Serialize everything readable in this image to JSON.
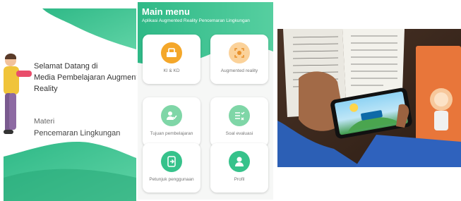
{
  "welcome_screen": {
    "greeting_line1": "Selamat Datang di",
    "greeting_line2": "Media Pembelajaran Augmente",
    "greeting_line3": "Reality",
    "materi_label": "Materi",
    "materi_subject": "Pencemaran Lingkungan"
  },
  "main_menu": {
    "title": "Main menu",
    "subtitle": "Aplikasi Augmented Reality Pencemaran Lingkungan",
    "items": [
      {
        "label": "KI & KD",
        "icon": "ki-kd-icon"
      },
      {
        "label": "Augmented reality",
        "icon": "augmented-reality-icon"
      },
      {
        "label": "Tujuan pembelajaran",
        "icon": "learning-goals-icon"
      },
      {
        "label": "Soal evaluasi",
        "icon": "evaluation-icon"
      },
      {
        "label": "Petunjuk penggunaan",
        "icon": "user-guide-icon"
      },
      {
        "label": "Profil",
        "icon": "profile-icon"
      }
    ]
  },
  "colors": {
    "brand_green": "#2fb987",
    "accent_orange": "#f4a72a",
    "card_bg": "#ffffff"
  }
}
